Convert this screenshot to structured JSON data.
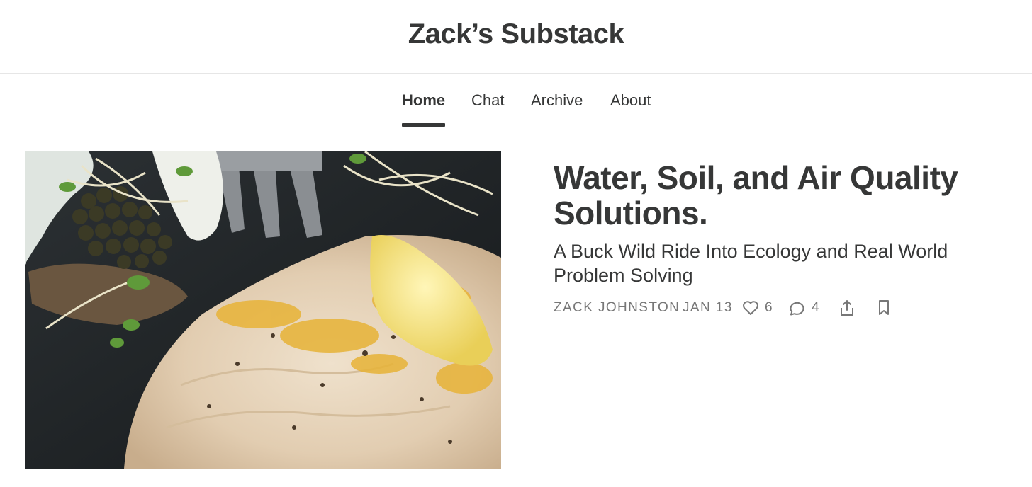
{
  "publication": {
    "title": "Zack’s Substack"
  },
  "nav": {
    "items": [
      {
        "label": "Home",
        "active": true
      },
      {
        "label": "Chat",
        "active": false
      },
      {
        "label": "Archive",
        "active": false
      },
      {
        "label": "About",
        "active": false
      }
    ]
  },
  "post": {
    "title": "Water, Soil, and Air Quality Solutions.",
    "subtitle": "A Buck Wild Ride Into Ecology and Real World Problem Solving",
    "author": "ZACK JOHNSTON",
    "date": "JAN 13",
    "likes": "6",
    "comments": "4",
    "icons": {
      "like": "heart-icon",
      "comment": "comment-icon",
      "share": "share-icon",
      "bookmark": "bookmark-icon"
    }
  },
  "hero_image": {
    "subject": "plated fish fillet with butter, caviar on cracker, microgreens and a fork"
  },
  "colors": {
    "text": "#363737",
    "muted": "#777777",
    "divider": "#e6e6e6"
  }
}
